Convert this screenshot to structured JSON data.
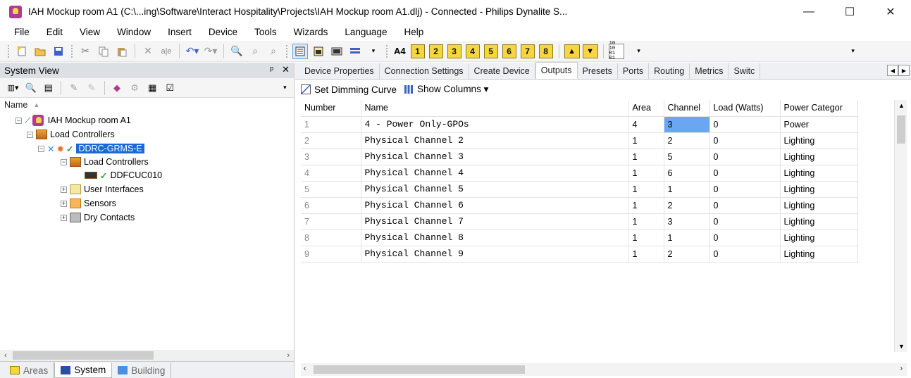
{
  "window": {
    "title": "IAH Mockup room A1 (C:\\...ing\\Software\\Interact Hospitality\\Projects\\IAH Mockup room A1.dlj) - Connected - Philips Dynalite S...",
    "minimize": "—",
    "maximize": "☐",
    "close": "✕"
  },
  "menu": [
    "File",
    "Edit",
    "View",
    "Window",
    "Insert",
    "Device",
    "Tools",
    "Wizards",
    "Language",
    "Help"
  ],
  "toolbar": {
    "a4_label": "A4",
    "numbers": [
      "1",
      "2",
      "3",
      "4",
      "5",
      "6",
      "7",
      "8"
    ]
  },
  "left_panel": {
    "title": "System View",
    "pin": "ᵖ",
    "close": "✕",
    "column_header": "Name",
    "tree": {
      "root": "IAH Mockup room A1",
      "load_controllers": "Load Controllers",
      "device": "DDRC-GRMS-E",
      "sub_load_controllers": "Load Controllers",
      "sub_device": "DDFCUC010",
      "user_interfaces": "User Interfaces",
      "sensors": "Sensors",
      "dry_contacts": "Dry Contacts"
    },
    "bottom_tabs": [
      "Areas",
      "System",
      "Building"
    ]
  },
  "right_panel": {
    "tabs": [
      "Device Properties",
      "Connection Settings",
      "Create Device",
      "Outputs",
      "Presets",
      "Ports",
      "Routing",
      "Metrics",
      "Switc"
    ],
    "active_tab": "Outputs",
    "actions": {
      "set_dimming_curve": "Set Dimming Curve",
      "show_columns": "Show Columns ▾"
    },
    "columns": [
      "Number",
      "Name",
      "Area",
      "Channel",
      "Load (Watts)",
      "Power Categor"
    ],
    "rows": [
      {
        "number": "1",
        "name": "4 - Power Only-GPOs",
        "area": "4",
        "channel": "3",
        "load": "0",
        "category": "Power"
      },
      {
        "number": "2",
        "name": "Physical Channel 2",
        "area": "1",
        "channel": "2",
        "load": "0",
        "category": "Lighting"
      },
      {
        "number": "3",
        "name": "Physical Channel 3",
        "area": "1",
        "channel": "5",
        "load": "0",
        "category": "Lighting"
      },
      {
        "number": "4",
        "name": "Physical Channel 4",
        "area": "1",
        "channel": "6",
        "load": "0",
        "category": "Lighting"
      },
      {
        "number": "5",
        "name": "Physical Channel 5",
        "area": "1",
        "channel": "1",
        "load": "0",
        "category": "Lighting"
      },
      {
        "number": "6",
        "name": "Physical Channel 6",
        "area": "1",
        "channel": "2",
        "load": "0",
        "category": "Lighting"
      },
      {
        "number": "7",
        "name": "Physical Channel 7",
        "area": "1",
        "channel": "3",
        "load": "0",
        "category": "Lighting"
      },
      {
        "number": "8",
        "name": "Physical Channel 8",
        "area": "1",
        "channel": "1",
        "load": "0",
        "category": "Lighting"
      },
      {
        "number": "9",
        "name": "Physical Channel 9",
        "area": "1",
        "channel": "2",
        "load": "0",
        "category": "Lighting"
      }
    ]
  }
}
